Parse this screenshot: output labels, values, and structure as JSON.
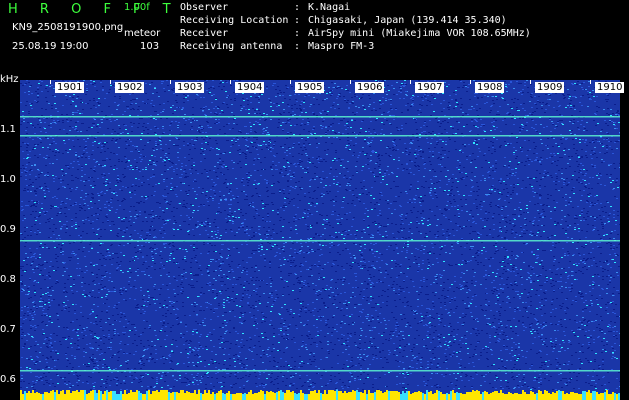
{
  "header": {
    "app_name": "H R O F F T",
    "version": "1.00f",
    "filename": "KN9_2508191900.png",
    "timestamp": "25.08.19 19:00",
    "meteor_label": "meteor",
    "meteor_count": "103"
  },
  "info": [
    {
      "key": "Observer",
      "value": "K.Nagai"
    },
    {
      "key": "Receiving Location",
      "value": "Chigasaki, Japan (139.414 35.340)"
    },
    {
      "key": "Receiver",
      "value": "AirSpy mini (Miakejima VOR 108.65MHz)"
    },
    {
      "key": "Receiving antenna",
      "value": "Maspro FM-3"
    }
  ],
  "y_axis": {
    "unit": "kHz",
    "ticks": [
      "1.1",
      "1.0",
      "0.9",
      "0.8",
      "0.7",
      "0.6"
    ]
  },
  "x_axis": {
    "ticks": [
      "1901",
      "1902",
      "1903",
      "1904",
      "1905",
      "1906",
      "1907",
      "1908",
      "1909",
      "1910"
    ]
  },
  "colors": {
    "background": "#000000",
    "spectrum_base": "#1a36a8",
    "noise_low": "#0a1e8c",
    "noise_high": "#2ee6ff",
    "signal_line": "#5cf5d0",
    "baseline": "#ffe600",
    "accent_text": "#3dff3d"
  }
}
